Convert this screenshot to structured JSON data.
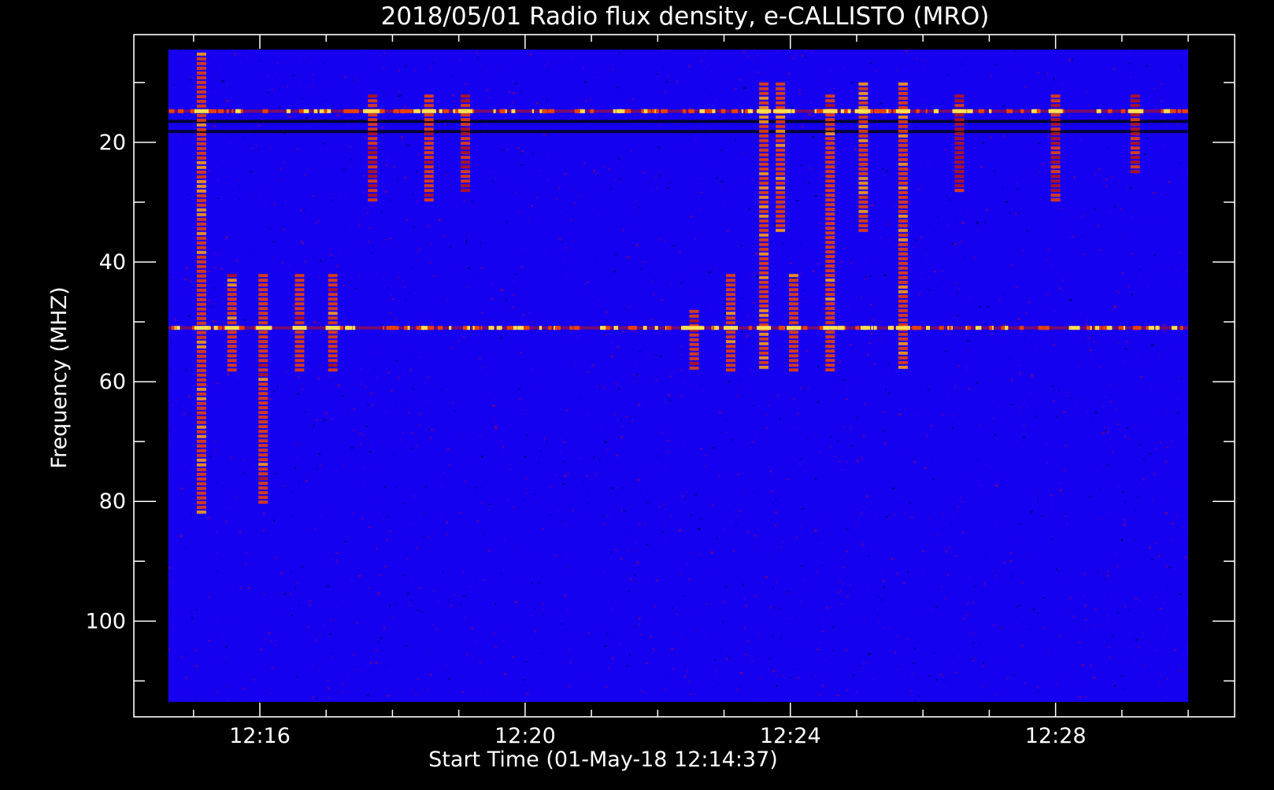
{
  "chart_data": {
    "type": "heatmap",
    "title": "2018/05/01  Radio flux density, e-CALLISTO (MRO)",
    "xlabel": "Start Time (01-May-18 12:14:37)",
    "ylabel": "Frequency (MHZ)",
    "x_tick_labels": [
      "12:16",
      "12:20",
      "12:24",
      "12:28"
    ],
    "x_tick_minutes": [
      16,
      20,
      24,
      28
    ],
    "x_range_minutes": [
      14.1,
      30.7
    ],
    "data_range_minutes": [
      14.62,
      30.0
    ],
    "y_tick_values": [
      20,
      40,
      60,
      80,
      100
    ],
    "y_range": [
      2,
      116
    ],
    "data_range_freq": [
      4.5,
      113.5
    ],
    "y_inverted": true,
    "colormap": [
      "#00007a",
      "#1400ff",
      "#3a00d8",
      "#7a0080",
      "#b81418",
      "#e8400a",
      "#ff9a10",
      "#ffe050"
    ],
    "background_color": "#1600f0",
    "bands": [
      {
        "freq": 14.8,
        "intensity": 0.85
      },
      {
        "freq": 16.5,
        "intensity": -0.8
      },
      {
        "freq": 18.2,
        "intensity": -0.5
      },
      {
        "freq": 51.0,
        "intensity": 0.75
      }
    ],
    "bursts": [
      {
        "time": 15.12,
        "freq_range": [
          5,
          82
        ],
        "intensity": 0.85
      },
      {
        "time": 15.58,
        "freq_range": [
          42,
          58
        ],
        "intensity": 0.8
      },
      {
        "time": 16.05,
        "freq_range": [
          42,
          80
        ],
        "intensity": 0.8
      },
      {
        "time": 16.6,
        "freq_range": [
          42,
          58
        ],
        "intensity": 0.8
      },
      {
        "time": 17.1,
        "freq_range": [
          42,
          58
        ],
        "intensity": 0.8
      },
      {
        "time": 17.7,
        "freq_range": [
          12,
          30
        ],
        "intensity": 0.65
      },
      {
        "time": 18.55,
        "freq_range": [
          12,
          30
        ],
        "intensity": 0.65
      },
      {
        "time": 19.1,
        "freq_range": [
          12,
          28
        ],
        "intensity": 0.6
      },
      {
        "time": 22.55,
        "freq_range": [
          48,
          58
        ],
        "intensity": 0.7
      },
      {
        "time": 23.1,
        "freq_range": [
          42,
          58
        ],
        "intensity": 0.85
      },
      {
        "time": 23.6,
        "freq_range": [
          10,
          58
        ],
        "intensity": 0.9
      },
      {
        "time": 23.85,
        "freq_range": [
          10,
          35
        ],
        "intensity": 0.9
      },
      {
        "time": 24.05,
        "freq_range": [
          42,
          58
        ],
        "intensity": 0.8
      },
      {
        "time": 24.6,
        "freq_range": [
          12,
          58
        ],
        "intensity": 0.8
      },
      {
        "time": 25.1,
        "freq_range": [
          10,
          35
        ],
        "intensity": 0.95
      },
      {
        "time": 25.7,
        "freq_range": [
          10,
          58
        ],
        "intensity": 0.85
      },
      {
        "time": 26.55,
        "freq_range": [
          12,
          28
        ],
        "intensity": 0.5
      },
      {
        "time": 28.0,
        "freq_range": [
          12,
          30
        ],
        "intensity": 0.65
      },
      {
        "time": 29.2,
        "freq_range": [
          12,
          25
        ],
        "intensity": 0.55
      }
    ],
    "grid": false,
    "legend": "none"
  }
}
